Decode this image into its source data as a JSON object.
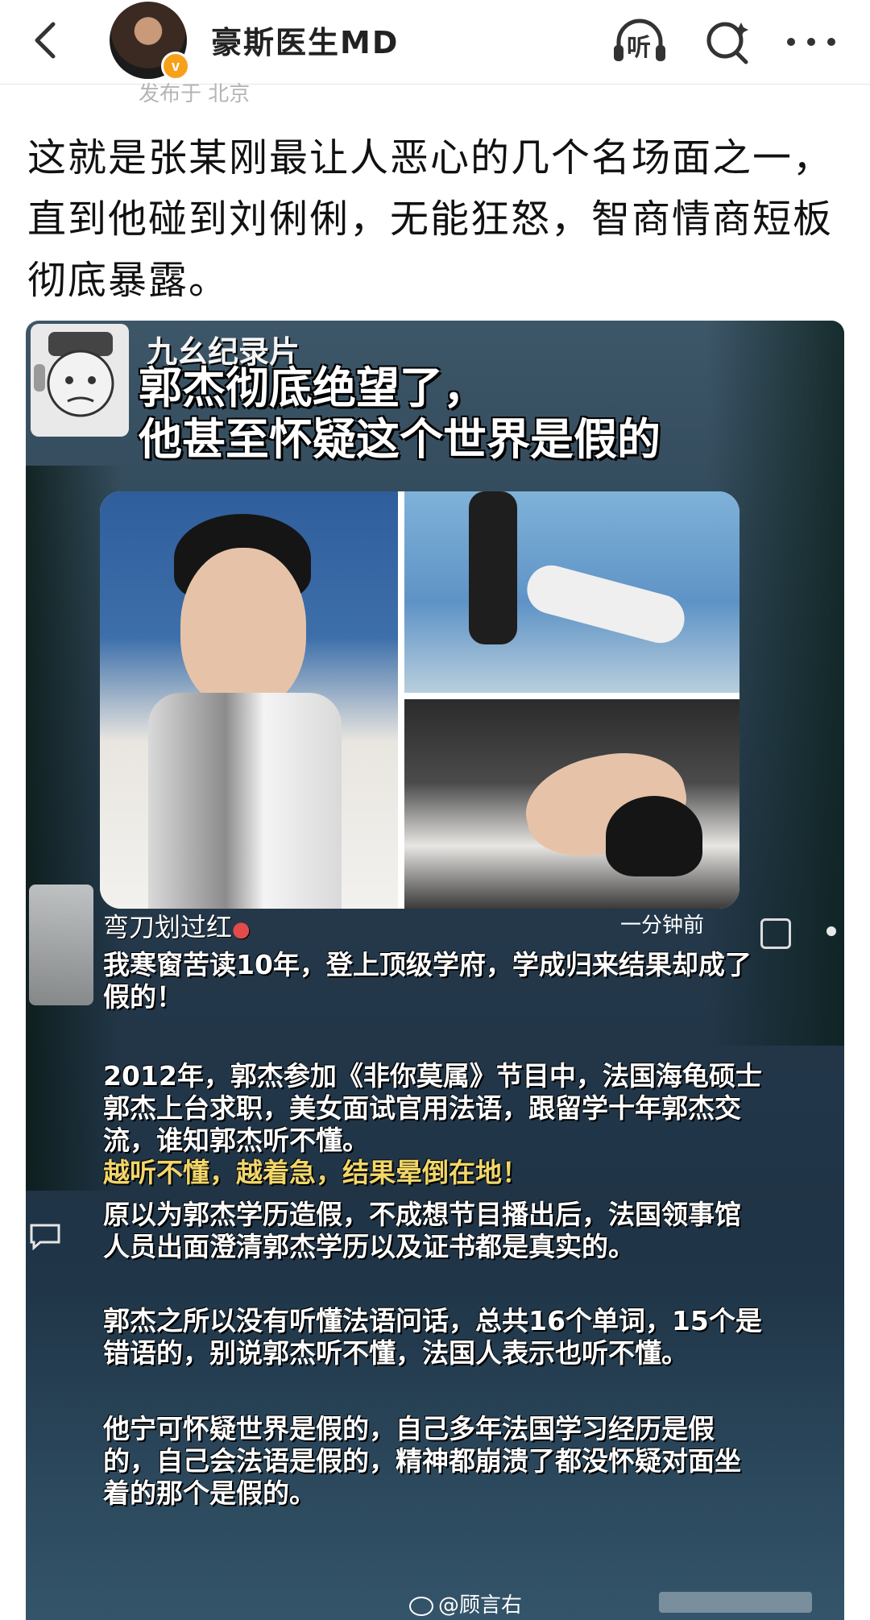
{
  "header": {
    "username": "豪斯医生MD",
    "verified_badge": "v",
    "location_text": "发布于 北京",
    "icons": [
      "back-icon",
      "listen-icon",
      "search-icon",
      "more-icon"
    ],
    "listen_label": "听"
  },
  "post": {
    "text": "这就是张某刚最让人恶心的几个名场面之一，直到他碰到刘俐俐，无能狂怒，智商情商短板彻底暴露。"
  },
  "image": {
    "tag": "九幺纪录片",
    "headline_line1": "郭杰彻底绝望了，",
    "headline_line2": "他甚至怀疑这个世界是假的",
    "comment": {
      "name": "弯刀划过红",
      "time": "一分钟前",
      "p1": "我寒窗苦读10年，登上顶级学府，学成归来结果却成了假的！",
      "p2a": "2012年，郭杰参加《非你莫属》节目中，法国海龟硕士郭杰上台求职，美女面试官用法语，跟留学十年郭杰交流，谁知郭杰听不懂。",
      "p2b": "越听不懂，越着急，结果晕倒在地！",
      "p3": "原以为郭杰学历造假，不成想节目播出后，法国领事馆人员出面澄清郭杰学历以及证书都是真实的。",
      "p4": "郭杰之所以没有听懂法语问话，总共16个单词，15个是错语的，别说郭杰听不懂，法国人表示也听不懂。",
      "p5": "他宁可怀疑世界是假的，自己多年法国学习经历是假的，自己会法语是假的，精神都崩溃了都没怀疑对面坐着的那个是假的。"
    },
    "watermark": "@顾言右"
  },
  "colors": {
    "accent_orange": "#f7a11a",
    "highlight_yellow": "#f1d66a",
    "text_dark": "#111111"
  }
}
